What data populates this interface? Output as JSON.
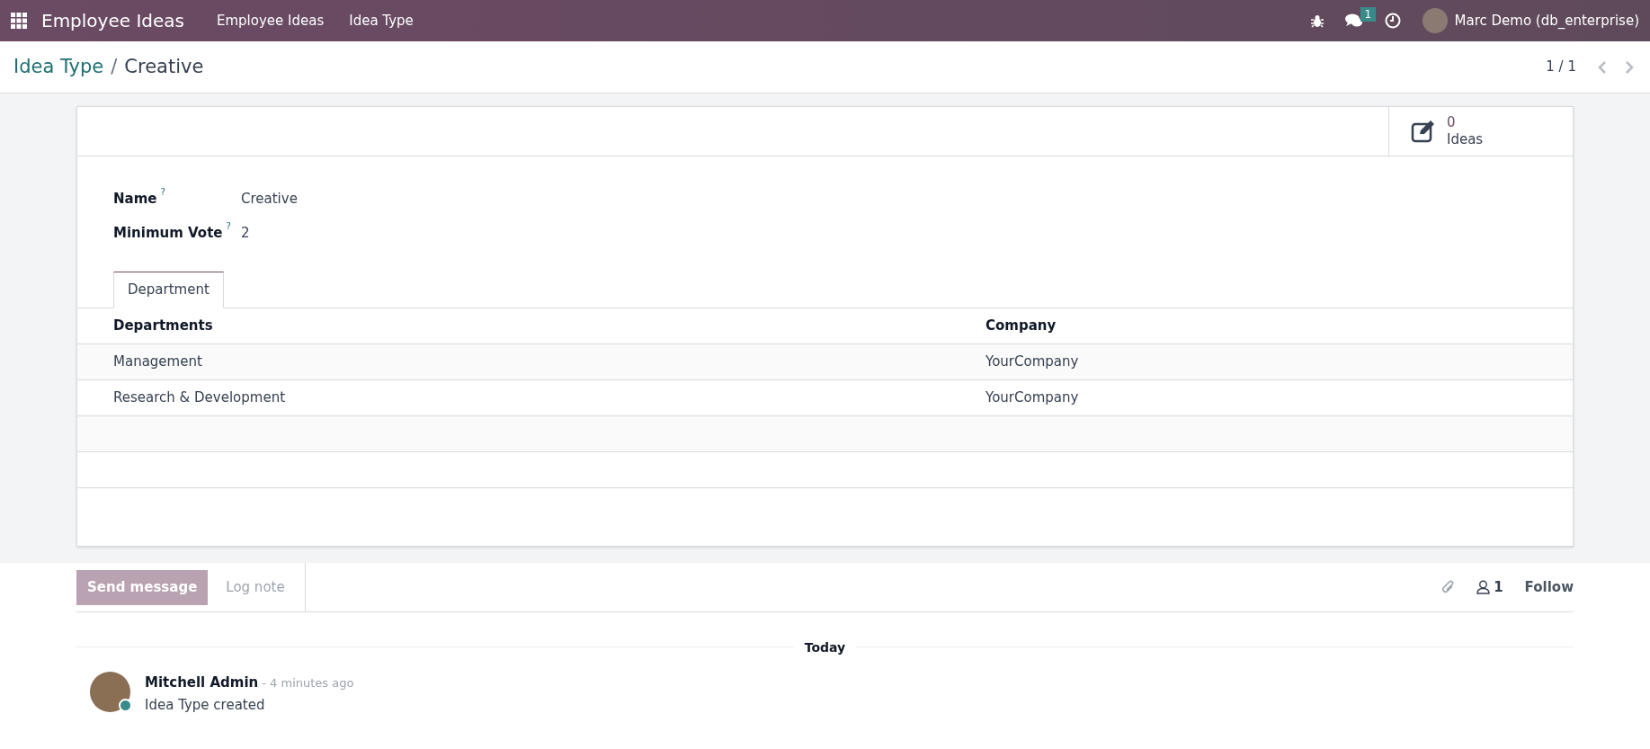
{
  "navbar": {
    "app_name": "Employee Ideas",
    "menu": [
      {
        "label": "Employee Ideas"
      },
      {
        "label": "Idea Type"
      }
    ],
    "messages_badge": "1",
    "user": "Marc Demo (db_enterprise)"
  },
  "breadcrumb": {
    "parent": "Idea Type",
    "separator": "/",
    "current": "Creative"
  },
  "pager": {
    "value": "1 / 1"
  },
  "smart_button": {
    "count": "0",
    "label": "Ideas"
  },
  "fields": [
    {
      "label": "Name",
      "help": "?",
      "value": "Creative"
    },
    {
      "label": "Minimum Vote",
      "help": "?",
      "value": "2"
    }
  ],
  "tabs": [
    {
      "label": "Department",
      "selected": true
    }
  ],
  "table": {
    "columns": [
      "Departments",
      "Company"
    ],
    "rows": [
      [
        "Management",
        "YourCompany"
      ],
      [
        "Research & Development",
        "YourCompany"
      ]
    ]
  },
  "chatter": {
    "tabs": [
      {
        "label": "Send message",
        "selected": true
      },
      {
        "label": "Log note",
        "selected": false
      }
    ],
    "followers": "1",
    "follow": "Follow",
    "date_separator": "Today",
    "messages": [
      {
        "author": "Mitchell Admin",
        "time": "- 4 minutes ago",
        "body": "Idea Type created"
      }
    ]
  }
}
